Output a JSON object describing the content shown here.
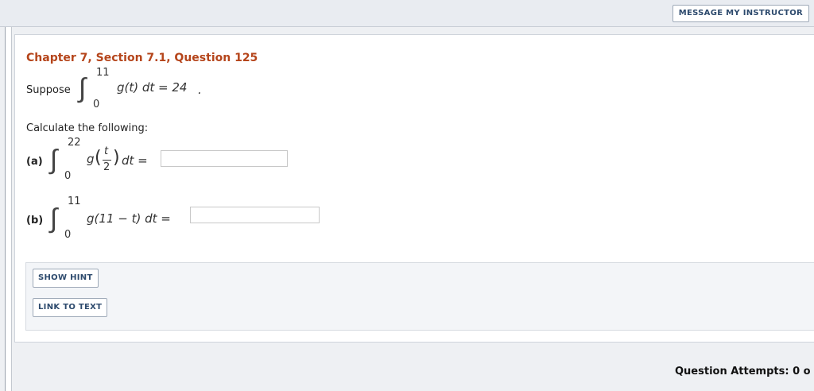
{
  "header": {
    "message_instructor_label": "MESSAGE MY INSTRUCTOR"
  },
  "question": {
    "title": "Chapter 7, Section 7.1, Question 125",
    "suppose_text": "Suppose",
    "given": {
      "upper": "11",
      "lower": "0",
      "integrand": "g(t) dt = 24",
      "end": "."
    },
    "calc_text": "Calculate the following:",
    "parts": [
      {
        "label": "(a)",
        "upper": "22",
        "lower": "0",
        "integrand_pre": "g",
        "frac_num": "t",
        "frac_den": "2",
        "integrand_post": "dt =",
        "answer": ""
      },
      {
        "label": "(b)",
        "upper": "11",
        "lower": "0",
        "integrand": "g(11 − t) dt =",
        "answer": ""
      }
    ]
  },
  "hints": {
    "show_hint_label": "SHOW HINT",
    "link_to_text_label": "LINK TO TEXT"
  },
  "footer": {
    "attempts_text": "Question Attempts: 0 o"
  }
}
